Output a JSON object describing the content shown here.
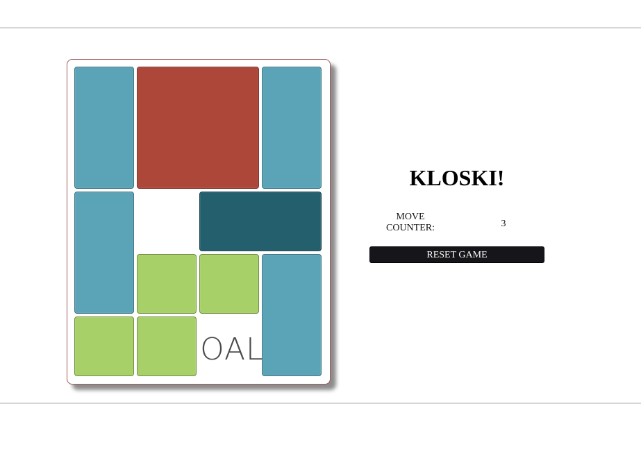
{
  "game": {
    "title": "KLOSKI!",
    "counter_label": "MOVE COUNTER:",
    "counter_value": "3",
    "reset_label": "RESET GAME",
    "goal_label": "GOAL"
  },
  "board": {
    "columns": 4,
    "rows": 5,
    "pieces": [
      {
        "kind": "tall",
        "col": 0,
        "row": 0
      },
      {
        "kind": "big",
        "col": 1,
        "row": 0
      },
      {
        "kind": "tall",
        "col": 3,
        "row": 0
      },
      {
        "kind": "tall",
        "col": 0,
        "row": 2
      },
      {
        "kind": "wide",
        "col": 2,
        "row": 2
      },
      {
        "kind": "small",
        "col": 1,
        "row": 3
      },
      {
        "kind": "small",
        "col": 2,
        "row": 3
      },
      {
        "kind": "tall",
        "col": 3,
        "row": 3
      },
      {
        "kind": "small",
        "col": 0,
        "row": 4
      },
      {
        "kind": "small",
        "col": 1,
        "row": 4
      }
    ]
  },
  "colors": {
    "tall": "#5ba3b6",
    "big": "#ad4739",
    "wide": "#235f6c",
    "small": "#a8d068",
    "button": "#16161a"
  }
}
